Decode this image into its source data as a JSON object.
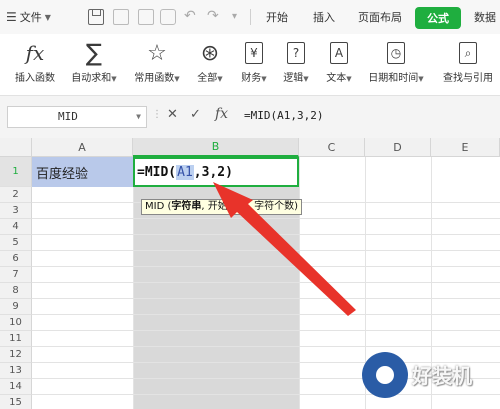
{
  "menubar": {
    "file_label": "文件",
    "tabs": [
      "开始",
      "插入",
      "页面布局",
      "公式",
      "数据"
    ],
    "active_tab": "公式"
  },
  "ribbon": {
    "buttons": [
      {
        "icon": "fx-icon",
        "label": "插入函数"
      },
      {
        "icon": "sum-icon",
        "label": "自动求和"
      },
      {
        "icon": "star-icon",
        "label": "常用函数"
      },
      {
        "icon": "all-functions-icon",
        "label": "全部"
      },
      {
        "icon": "yen-icon",
        "label": "财务"
      },
      {
        "icon": "question-icon",
        "label": "逻辑"
      },
      {
        "icon": "text-a-icon",
        "label": "文本"
      },
      {
        "icon": "clock-icon",
        "label": "日期和时间"
      },
      {
        "icon": "lookup-icon",
        "label": "查找与引用"
      }
    ]
  },
  "formula_bar": {
    "name_box": "MID",
    "formula": "=MID(A1,3,2)"
  },
  "grid": {
    "columns": [
      "A",
      "B",
      "C",
      "D",
      "E"
    ],
    "selected_column": "B",
    "rows": [
      "1",
      "2",
      "3",
      "4",
      "5",
      "6",
      "7",
      "8",
      "9",
      "10",
      "11",
      "12",
      "13",
      "14",
      "15"
    ],
    "cell_A1": "百度经验",
    "cell_B1": {
      "prefix": "=MID(",
      "ref": "A1",
      "suffix": ",3,2)"
    }
  },
  "tooltip": {
    "func": "MID",
    "open": " (",
    "arg1": "字符串",
    "rest": ", 开始位置, 字符个数)"
  },
  "watermark": {
    "text": "好装机"
  },
  "colors": {
    "accent_green": "#1fae3f",
    "selection_blue": "#b9c9ea",
    "arrow_red": "#e8332a"
  }
}
